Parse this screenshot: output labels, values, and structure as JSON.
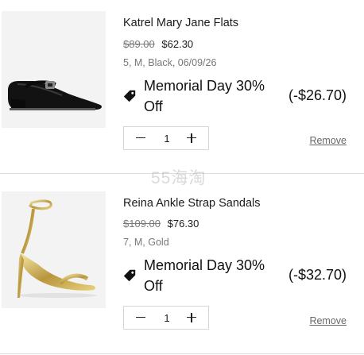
{
  "cart": {
    "items": [
      {
        "name": "Katrel Mary Jane Flats",
        "original_price": "$89.00",
        "sale_price": "$62.30",
        "variant": "5, M, Black, 06/09/26",
        "promo_name": "Memorial Day 30% Off",
        "promo_amount": "(-$26.70)",
        "quantity": "1",
        "remove_label": "Remove",
        "image_icon": "black-patent-mary-jane-flat"
      },
      {
        "name": "Reina Ankle Strap Sandals",
        "original_price": "$109.00",
        "sale_price": "$76.30",
        "variant": "7, M, Gold",
        "promo_name": "Memorial Day 30% Off",
        "promo_amount": "(-$32.70)",
        "quantity": "1",
        "remove_label": "Remove",
        "image_icon": "gold-ankle-strap-stiletto-sandal"
      }
    ]
  },
  "watermark": "55海淘",
  "icons": {
    "promo": "price-tag-icon",
    "decrease": "minus-icon",
    "increase": "plus-icon"
  },
  "colors": {
    "text": "#1a1a1a",
    "muted": "#777777",
    "divider": "#dcdcdc",
    "thumb_bg": "#f3f3f3"
  }
}
